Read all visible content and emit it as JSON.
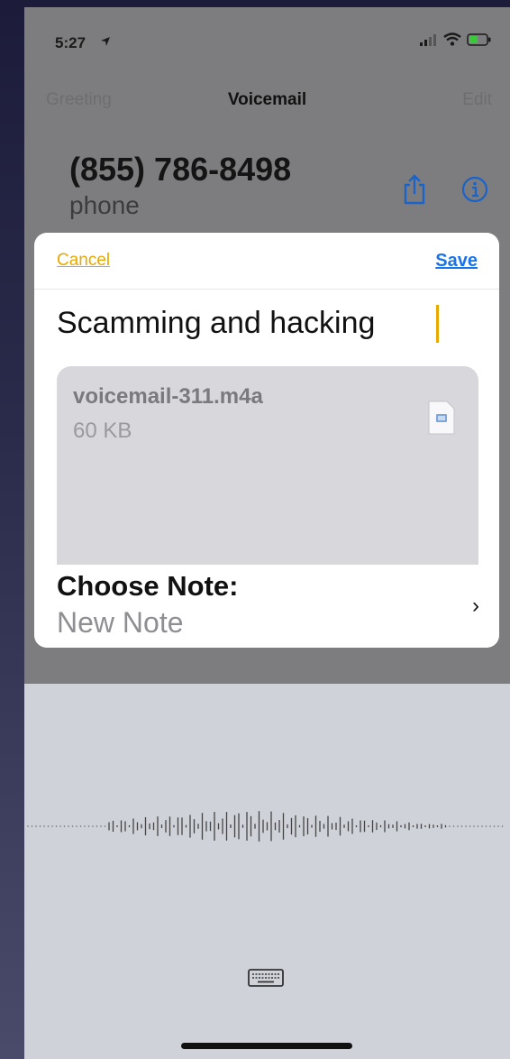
{
  "status_bar": {
    "time": "5:27",
    "icons": [
      "location-arrow-icon",
      "cellular-signal-icon",
      "wifi-icon",
      "battery-icon"
    ]
  },
  "nav": {
    "left_label": "Greeting",
    "title": "Voicemail",
    "right_label": "Edit"
  },
  "caller": {
    "number": "(855) 786-8498",
    "type": "phone",
    "actions": [
      "share-icon",
      "info-icon"
    ]
  },
  "share_sheet": {
    "cancel_label": "Cancel",
    "save_label": "Save",
    "title_value": "Scamming and hacking",
    "attachment": {
      "file_name": "voicemail-311.m4a",
      "file_size": "60 KB",
      "icon": "audio-file-icon"
    },
    "choose_note_label": "Choose Note:",
    "choose_note_value": "New Note"
  },
  "dictation": {
    "waveform_icon": "waveform-icon",
    "keyboard_icon": "keyboard-icon"
  },
  "colors": {
    "accent_yellow": "#e8a800",
    "link_blue": "#1a73e8",
    "dimmed_background": "#7d7d7f",
    "dictation_background": "#cfd2d9"
  }
}
